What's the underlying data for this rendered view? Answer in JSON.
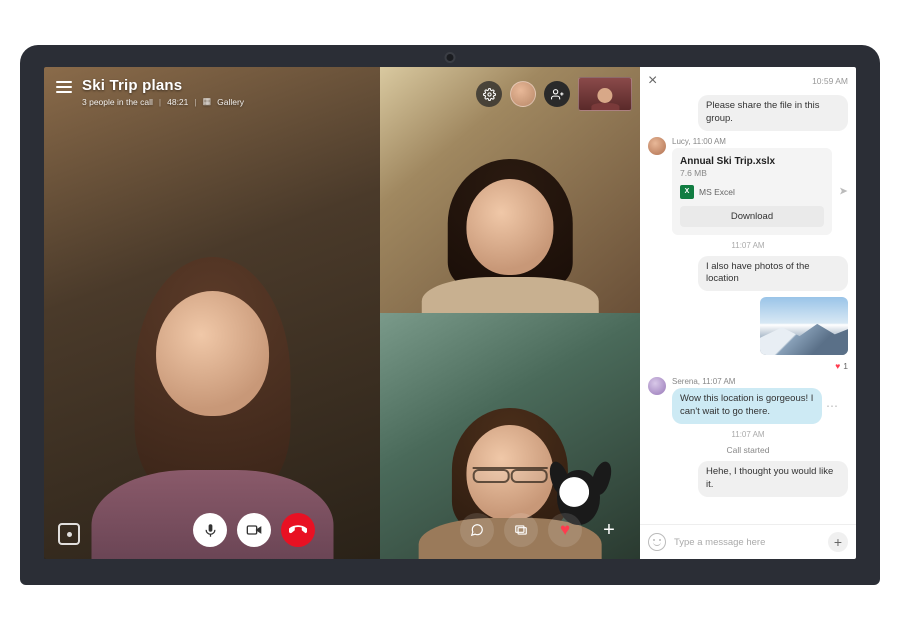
{
  "call": {
    "title": "Ski Trip plans",
    "subtitle_people": "3 people in the call",
    "duration": "48:21",
    "gallery_label": "Gallery"
  },
  "chat": {
    "header_time": "10:59 AM",
    "messages": {
      "m1": {
        "text": "Please share the file in this group."
      },
      "m2": {
        "sender": "Lucy",
        "time": "11:00 AM"
      },
      "file": {
        "name": "Annual Ski Trip.xslx",
        "size": "7.6 MB",
        "type_label": "MS Excel",
        "download_label": "Download"
      },
      "t1": "11:07 AM",
      "m3": {
        "text": "I also have photos of the location"
      },
      "reaction_count": "1",
      "m4": {
        "sender": "Serena",
        "time": "11:07 AM",
        "text": "Wow this location is gorgeous! I can't wait to go there."
      },
      "t2": "11:07 AM",
      "sys": "Call started",
      "m5": {
        "text": "Hehe, I thought you would like it."
      }
    },
    "input_placeholder": "Type a message here"
  }
}
